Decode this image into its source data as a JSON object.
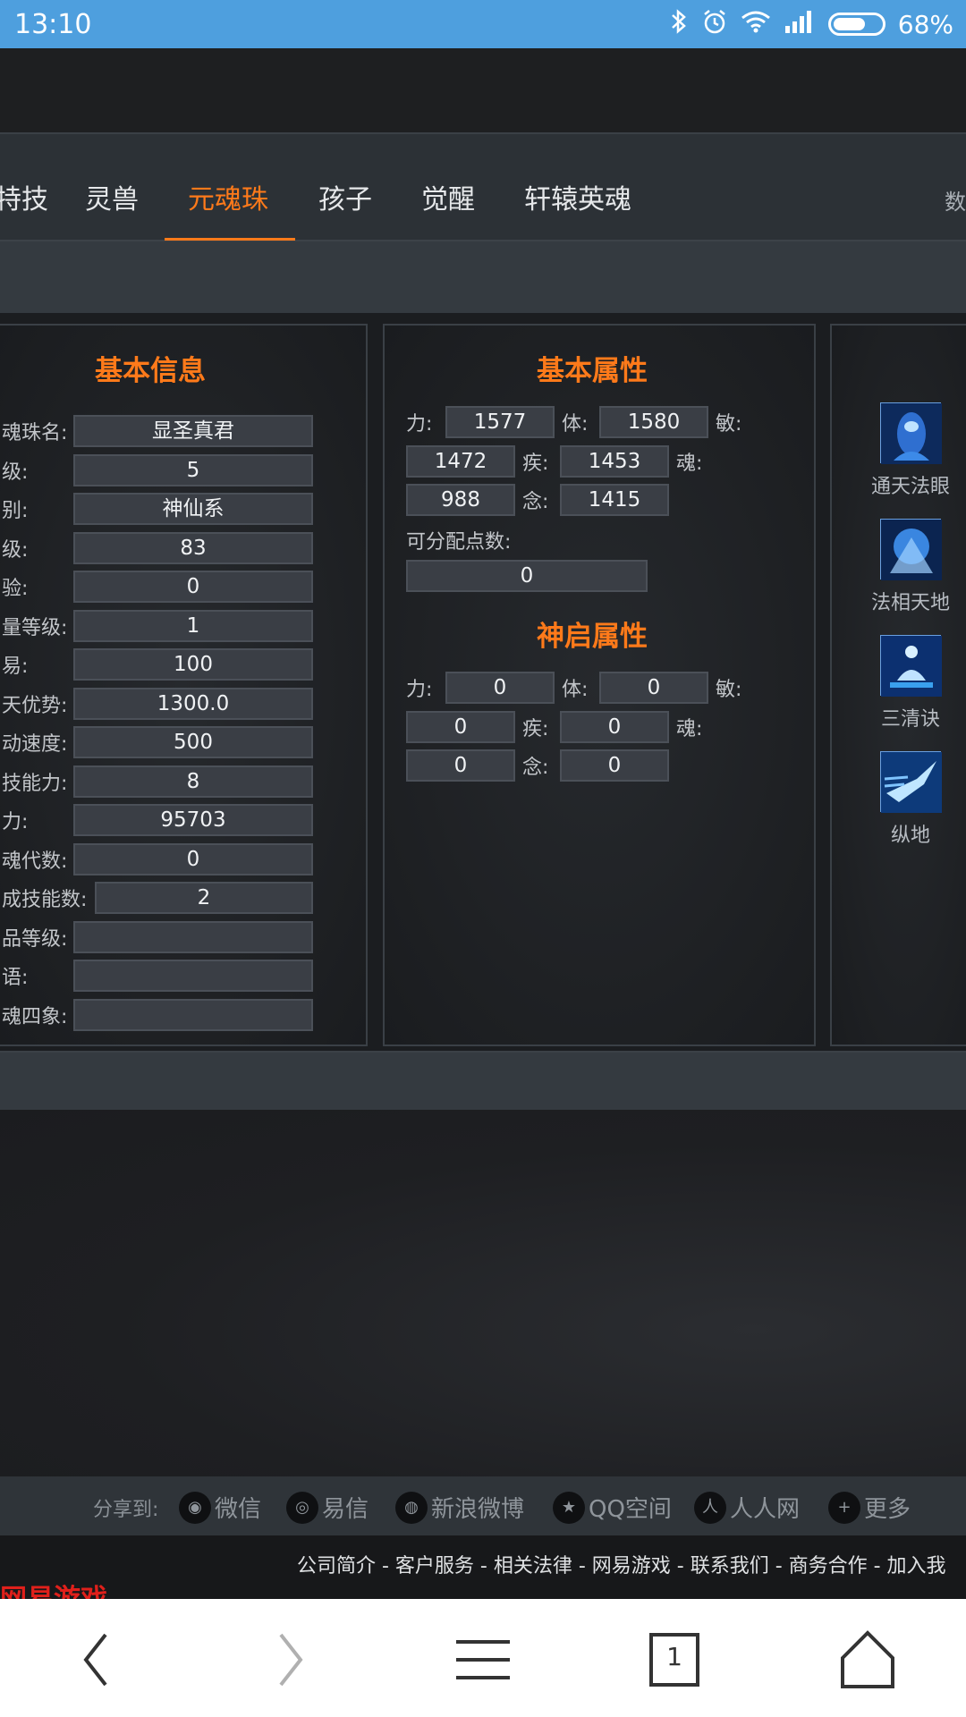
{
  "status_bar": {
    "time": "13:10",
    "battery": "68%",
    "battery_level": 0.68
  },
  "tabs": {
    "items": [
      {
        "label": "特技",
        "active": false
      },
      {
        "label": "灵兽",
        "active": false
      },
      {
        "label": "元魂珠",
        "active": true
      },
      {
        "label": "孩子",
        "active": false
      },
      {
        "label": "觉醒",
        "active": false
      },
      {
        "label": "轩辕英魂",
        "active": false
      }
    ],
    "cut_label": "数"
  },
  "basic_info": {
    "title": "基本信息",
    "rows": [
      {
        "label": "魂珠名:",
        "value": "显圣真君"
      },
      {
        "label": "级:",
        "value": "5"
      },
      {
        "label": "别:",
        "value": "神仙系"
      },
      {
        "label": "级:",
        "value": "83"
      },
      {
        "label": "验:",
        "value": "0"
      },
      {
        "label": "量等级:",
        "value": "1"
      },
      {
        "label": "易:",
        "value": "100"
      },
      {
        "label": "天优势:",
        "value": "1300.0"
      },
      {
        "label": "动速度:",
        "value": "500"
      },
      {
        "label": "技能力:",
        "value": "8"
      },
      {
        "label": "力:",
        "value": "95703"
      },
      {
        "label": "魂代数:",
        "value": "0"
      },
      {
        "label": "成技能数:",
        "value": "2"
      },
      {
        "label": "品等级:",
        "value": ""
      },
      {
        "label": "语:",
        "value": ""
      },
      {
        "label": "魂四象:",
        "value": ""
      }
    ]
  },
  "basic_attr": {
    "title": "基本属性",
    "labels": {
      "li": "力:",
      "ti": "体:",
      "min": "敏:",
      "ji": "疾:",
      "hun": "魂:",
      "nian": "念:"
    },
    "li": "1577",
    "ti": "1580",
    "min": "1472",
    "ji": "1453",
    "hun": "988",
    "nian": "1415",
    "points_label": "可分配点数:",
    "points": "0"
  },
  "shenqi_attr": {
    "title": "神启属性",
    "li": "0",
    "ti": "0",
    "min": "0",
    "ji": "0",
    "hun": "0",
    "nian": "0"
  },
  "skills": [
    {
      "name": "通天法眼",
      "icon": "eye-skill-icon",
      "color": "#2f6fd0"
    },
    {
      "name": "法相天地",
      "icon": "giant-skill-icon",
      "color": "#3a86e0"
    },
    {
      "name": "三清诀",
      "icon": "meditation-skill-icon",
      "color": "#2e7be6"
    },
    {
      "name": "纵地",
      "icon": "dash-skill-icon",
      "color": "#3aa0ee"
    }
  ],
  "share": {
    "lead": "分享到:",
    "items": [
      {
        "label": "微信",
        "icon": "wechat-icon"
      },
      {
        "label": "易信",
        "icon": "yixin-icon"
      },
      {
        "label": "新浪微博",
        "icon": "weibo-icon"
      },
      {
        "label": "QQ空间",
        "icon": "qzone-icon"
      },
      {
        "label": "人人网",
        "icon": "renren-icon"
      },
      {
        "label": "更多",
        "icon": "plus-icon"
      }
    ]
  },
  "footer": {
    "links": "公司简介 - 客户服务 - 相关法律 - 网易游戏 - 联系我们 - 商务合作 - 加入我",
    "logo": "网易游戏"
  },
  "navbar": {
    "tab_count": "1"
  },
  "colors": {
    "accent": "#ff7a1a",
    "status_bar": "#4e9fde"
  }
}
